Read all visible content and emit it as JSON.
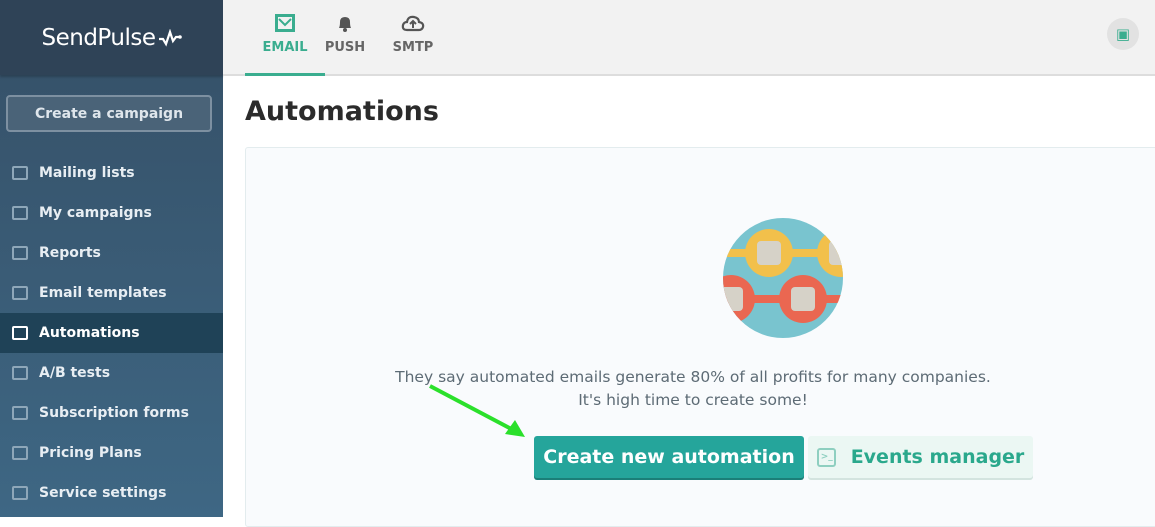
{
  "brand": {
    "name": "SendPulse",
    "accent": "#3aad8f"
  },
  "sidebar": {
    "create_label": "Create a campaign",
    "items": [
      {
        "label": "Mailing lists",
        "icon": "contacts-icon"
      },
      {
        "label": "My campaigns",
        "icon": "upload-icon"
      },
      {
        "label": "Reports",
        "icon": "chart-icon"
      },
      {
        "label": "Email templates",
        "icon": "template-icon"
      },
      {
        "label": "Automations",
        "icon": "automation-icon",
        "active": true
      },
      {
        "label": "A/B tests",
        "icon": "split-icon"
      },
      {
        "label": "Subscription forms",
        "icon": "form-icon"
      },
      {
        "label": "Pricing Plans",
        "icon": "wallet-icon"
      },
      {
        "label": "Service settings",
        "icon": "sliders-icon"
      }
    ]
  },
  "topbar": {
    "tabs": [
      {
        "label": "EMAIL",
        "icon": "envelope-icon",
        "active": true
      },
      {
        "label": "PUSH",
        "icon": "bell-icon"
      },
      {
        "label": "SMTP",
        "icon": "cloud-upload-icon"
      }
    ],
    "gift_icon": "gift-icon"
  },
  "main": {
    "title": "Automations",
    "message_line1": "They say automated emails generate 80% of all profits for many companies.",
    "message_line2": "It's high time to create some!",
    "create_button": "Create new automation",
    "events_button": "Events manager"
  }
}
